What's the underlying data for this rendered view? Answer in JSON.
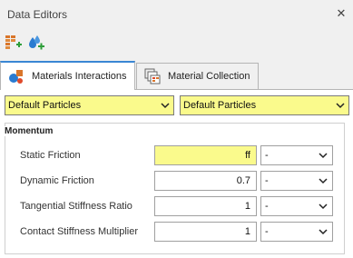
{
  "window": {
    "title": "Data Editors"
  },
  "toolbar": {
    "buttons": [
      {
        "name": "add-interaction-button",
        "icon": "grid-add-icon"
      },
      {
        "name": "add-material-button",
        "icon": "droplets-add-icon"
      }
    ]
  },
  "tabs": [
    {
      "label": "Materials Interactions",
      "icon": "materials-interactions-icon",
      "active": true
    },
    {
      "label": "Material Collection",
      "icon": "material-collection-icon",
      "active": false
    }
  ],
  "selectors": {
    "material_a": "Default Particles",
    "material_b": "Default Particles"
  },
  "momentum": {
    "title": "Momentum",
    "rows": [
      {
        "label": "Static Friction",
        "value": "ff",
        "unit": "-",
        "highlighted": true
      },
      {
        "label": "Dynamic Friction",
        "value": "0.7",
        "unit": "-",
        "highlighted": false
      },
      {
        "label": "Tangential Stiffness Ratio",
        "value": "1",
        "unit": "-",
        "highlighted": false
      },
      {
        "label": "Contact Stiffness Multiplier",
        "value": "1",
        "unit": "-",
        "highlighted": false
      }
    ]
  },
  "colors": {
    "highlight": "#fafa8c",
    "tab_accent": "#3a86d4",
    "add_green": "#2e9e3a",
    "brick": "#d9762b",
    "drop_blue": "#2a7bd1"
  }
}
